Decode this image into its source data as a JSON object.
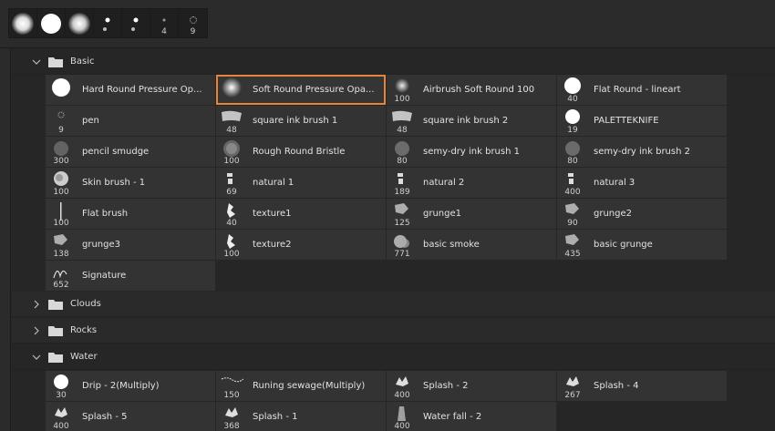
{
  "presets": [
    {
      "icon": "soft-brush-icon",
      "size": ""
    },
    {
      "icon": "hard-brush-icon",
      "size": ""
    },
    {
      "icon": "soft-brush-icon",
      "size": ""
    },
    {
      "icon": "small-dot-icon",
      "size": ""
    },
    {
      "icon": "small-dot-icon",
      "size": ""
    },
    {
      "icon": "tiny-dot-icon",
      "size": "4"
    },
    {
      "icon": "speckle-icon",
      "size": "9"
    }
  ],
  "groups": {
    "basic": {
      "name": "Basic",
      "rows": [
        [
          {
            "label": "Hard Round Pressure Op...",
            "size": "",
            "icon": "hard-round-icon"
          },
          {
            "label": "Soft Round Pressure Opa...",
            "size": "",
            "icon": "soft-round-icon",
            "selected": true
          },
          {
            "label": "Airbrush Soft Round 100",
            "size": "100",
            "icon": "airbrush-icon"
          },
          {
            "label": "Flat Round - lineart",
            "size": "40",
            "icon": "flat-round-icon"
          }
        ],
        [
          {
            "label": "pen",
            "size": "9",
            "icon": "pen-icon"
          },
          {
            "label": "square ink brush 1",
            "size": "48",
            "icon": "ink-brush-icon"
          },
          {
            "label": "square ink brush 2",
            "size": "48",
            "icon": "ink-brush-icon"
          },
          {
            "label": "PALETTEKNIFE",
            "size": "19",
            "icon": "palette-knife-icon"
          }
        ],
        [
          {
            "label": "pencil smudge",
            "size": "300",
            "icon": "smudge-icon"
          },
          {
            "label": "Rough Round Bristle",
            "size": "100",
            "icon": "bristle-icon"
          },
          {
            "label": "semy-dry ink brush 1",
            "size": "80",
            "icon": "dry-brush-icon"
          },
          {
            "label": "semy-dry ink brush 2",
            "size": "80",
            "icon": "dry-brush-icon"
          }
        ],
        [
          {
            "label": "Skin brush - 1",
            "size": "100",
            "icon": "skin-brush-icon"
          },
          {
            "label": "natural 1",
            "size": "69",
            "icon": "natural-icon"
          },
          {
            "label": "natural 2",
            "size": "189",
            "icon": "natural-icon"
          },
          {
            "label": "natural 3",
            "size": "400",
            "icon": "natural-icon"
          }
        ],
        [
          {
            "label": "Flat brush",
            "size": "100",
            "icon": "flat-brush-icon"
          },
          {
            "label": "texture1",
            "size": "40",
            "icon": "texture-icon"
          },
          {
            "label": "grunge1",
            "size": "125",
            "icon": "grunge-icon"
          },
          {
            "label": "grunge2",
            "size": "90",
            "icon": "grunge-icon"
          }
        ],
        [
          {
            "label": "grunge3",
            "size": "138",
            "icon": "grunge-icon"
          },
          {
            "label": "texture2",
            "size": "100",
            "icon": "texture-icon"
          },
          {
            "label": "basic smoke",
            "size": "771",
            "icon": "smoke-icon"
          },
          {
            "label": "basic grunge",
            "size": "435",
            "icon": "grunge-icon"
          }
        ],
        [
          {
            "label": "Signature",
            "size": "652",
            "icon": "signature-icon"
          }
        ]
      ]
    },
    "clouds": {
      "name": "Clouds"
    },
    "rocks": {
      "name": "Rocks"
    },
    "water": {
      "name": "Water",
      "rows": [
        [
          {
            "label": "Drip - 2(Multiply)",
            "size": "30",
            "icon": "drip-icon"
          },
          {
            "label": "Runing sewage(Multiply)",
            "size": "150",
            "icon": "sewage-icon"
          },
          {
            "label": "Splash - 2",
            "size": "400",
            "icon": "splash-icon"
          },
          {
            "label": "Splash - 4",
            "size": "267",
            "icon": "splash-icon"
          }
        ],
        [
          {
            "label": "Splash - 5",
            "size": "400",
            "icon": "splash-icon"
          },
          {
            "label": "Splash - 1",
            "size": "368",
            "icon": "splash-icon"
          },
          {
            "label": "Water fall - 2",
            "size": "400",
            "icon": "waterfall-icon"
          }
        ]
      ]
    }
  },
  "colors": {
    "selection": "#e8843a",
    "cell": "#333333",
    "panel": "#262626"
  }
}
